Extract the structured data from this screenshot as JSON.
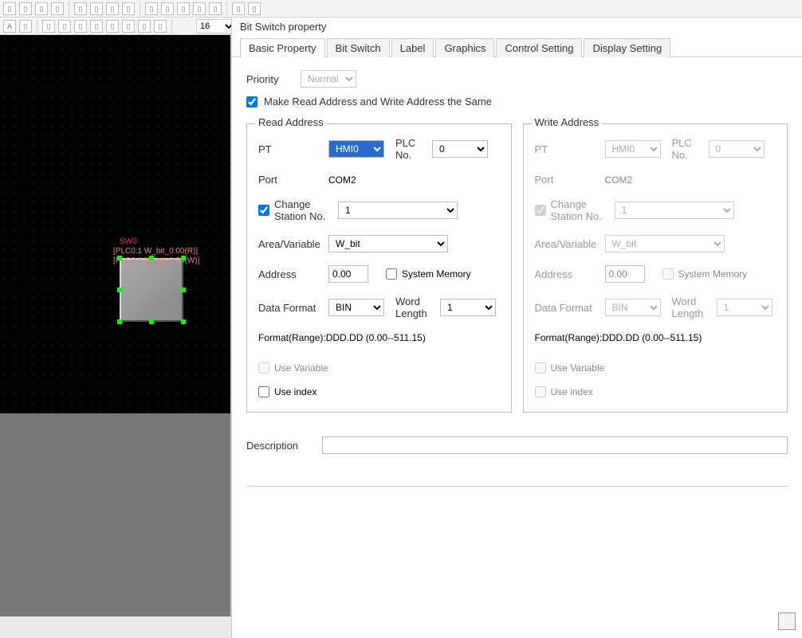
{
  "toolbar": {
    "font_size": "16"
  },
  "dialog": {
    "title": "Bit Switch property",
    "tabs": [
      "Basic Property",
      "Bit Switch",
      "Label",
      "Graphics",
      "Control Setting",
      "Display Setting"
    ],
    "priority_label": "Priority",
    "priority_value": "Normal",
    "same_addr_label": "Make Read Address and Write Address the Same"
  },
  "read": {
    "legend": "Read Address",
    "pt_label": "PT",
    "pt_value": "HMI0",
    "plc_label": "PLC No.",
    "plc_value": "0",
    "port_label": "Port",
    "port_value": "COM2",
    "change_station_label": "Change Station No.",
    "change_station_value": "1",
    "area_label": "Area/Variable",
    "area_value": "W_bit",
    "address_label": "Address",
    "address_value": "0.00",
    "sysmem_label": "System Memory",
    "dataformat_label": "Data Format",
    "dataformat_value": "BIN",
    "wordlen_label": "Word Length",
    "wordlen_value": "1",
    "format_range": "Format(Range):DDD.DD (0.00--511.15)",
    "use_variable": "Use Variable",
    "use_index": "Use index"
  },
  "write": {
    "legend": "Write Address",
    "pt_label": "PT",
    "pt_value": "HMI0",
    "plc_label": "PLC No.",
    "plc_value": "0",
    "port_label": "Port",
    "port_value": "COM2",
    "change_station_label": "Change Station No.",
    "change_station_value": "1",
    "area_label": "Area/Variable",
    "area_value": "W_bit",
    "address_label": "Address",
    "address_value": "0.00",
    "sysmem_label": "System Memory",
    "dataformat_label": "Data Format",
    "dataformat_value": "BIN",
    "wordlen_label": "Word Length",
    "wordlen_value": "1",
    "format_range": "Format(Range):DDD.DD (0.00--511.15)",
    "use_variable": "Use Variable",
    "use_index": "Use index"
  },
  "description_label": "Description",
  "canvas": {
    "obj_name": "SW0",
    "obj_r": "[PLC0:1 W_bit_0:00(R)]",
    "obj_w": "[PLC0:1 W_bit_0:00(W)]"
  }
}
